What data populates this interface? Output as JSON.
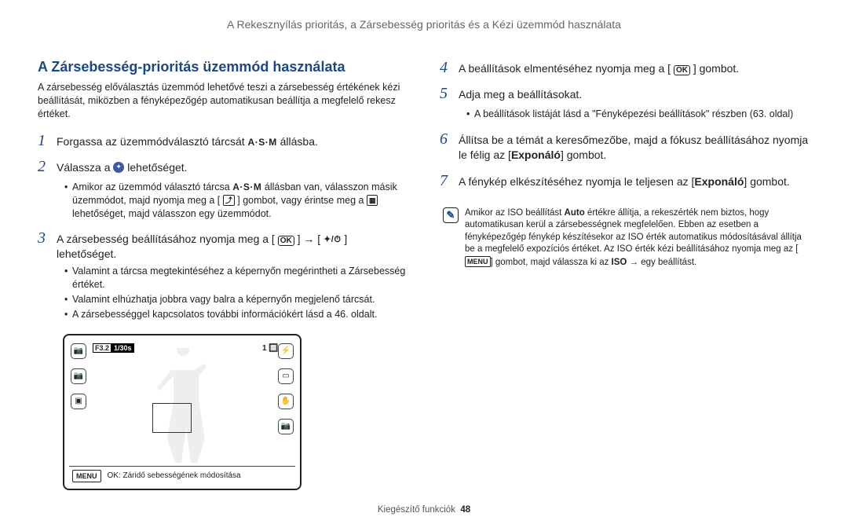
{
  "header": "A Rekesznyílás prioritás, a Zársebesség prioritás és a Kézi üzemmód használata",
  "section_title": "A Zársebesség-prioritás üzemmód használata",
  "intro": "A zársebesség előválasztás üzemmód lehetővé teszi a zársebesség értékének kézi beállítását, miközben a fényképezőgép automatikusan beállítja a megfelelő rekesz értéket.",
  "steps": {
    "s1a": "Forgassa az üzemmódválasztó tárcsát ",
    "s1b": " állásba.",
    "s2a": "Válassza a ",
    "s2b": " lehetőséget.",
    "s2_b1a": "Amikor az üzemmód választó tárcsa ",
    "s2_b1b": " állásban van, válasszon másik üzemmódot, majd nyomja meg a [",
    "s2_b1c": "] gombot, vagy érintse meg a ",
    "s2_b1d": " lehetőséget, majd válasszon egy üzemmódot.",
    "s3a": "A zársebesség beállításához nyomja meg a [",
    "s3b": "] → [",
    "s3c": "] lehetőséget.",
    "s3_b1": "Valamint a tárcsa megtekintéséhez a képernyőn megérintheti a Zársebesség értéket.",
    "s3_b2": "Valamint elhúzhatja jobbra vagy balra a képernyőn megjelenő tárcsát.",
    "s3_b3": "A zársebességgel kapcsolatos további információkért lásd a 46. oldalt.",
    "s4a": "A beállítások elmentéséhez nyomja meg a [",
    "s4b": "] gombot.",
    "s5": "Adja meg a beállításokat.",
    "s5_b1": "A beállítások listáját lásd a \"Fényképezési beállítások\" részben (63. oldal)",
    "s6a": "Állítsa be a témát a keresőmezőbe, majd a fókusz beállításához nyomja le félig az [",
    "s6b": "Exponáló",
    "s6c": "] gombot.",
    "s7a": "A fénykép elkészítéséhez nyomja le teljesen az [",
    "s7b": "Exponáló",
    "s7c": "] gombot."
  },
  "note": {
    "a": "Amikor az ISO beállítást ",
    "auto": "Auto",
    "b": " értékre állítja, a rekeszérték nem biztos, hogy automatikusan kerül a zársebességnek megfelelően. Ebben az esetben a fényképezőgép fénykép készítésekor az ISO érték automatikus módosításával állítja be a megfelelő expozíciós értéket. Az ISO érték kézi beállításához nyomja meg az [",
    "menu": "MENU",
    "c": "] gombot, majd válassza ki az ",
    "iso": "ISO",
    "d": " → egy beállítást."
  },
  "lcd": {
    "aperture": "F3.2",
    "shutter": "1/30s",
    "count": "1",
    "status": "OK: Záridő sebességének módosítása",
    "menu": "MENU"
  },
  "icons": {
    "asm": "A·S·M",
    "ok": "OK",
    "flash_timer": "✦/⏱"
  },
  "footer": {
    "label": "Kiegészítő funkciók",
    "page": "48"
  }
}
